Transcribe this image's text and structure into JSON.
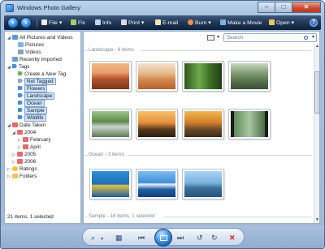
{
  "window": {
    "title": "Windows Photo Gallery",
    "controls": [
      "–",
      "□",
      "✕"
    ]
  },
  "toolbar": {
    "items": [
      {
        "label": "File",
        "icon": "file-icon"
      },
      {
        "label": "Fix",
        "icon": "fix-icon"
      },
      {
        "label": "Info",
        "icon": "info-icon"
      },
      {
        "label": "Print",
        "icon": "print-icon"
      },
      {
        "label": "E-mail",
        "icon": "email-icon"
      },
      {
        "label": "Burn",
        "icon": "burn-icon"
      },
      {
        "label": "Make a Movie",
        "icon": "movie-icon"
      },
      {
        "label": "Open",
        "icon": "open-icon"
      }
    ],
    "help": "?"
  },
  "nav": {
    "all": "All Pictures and Videos",
    "pictures": "Pictures",
    "videos": "Videos",
    "recent": "Recently Imported",
    "tags": "Tags",
    "create_tag": "Create a New Tag",
    "not_tagged": "Not Tagged",
    "flowers": "Flowers",
    "landscape": "Landscape",
    "ocean": "Ocean",
    "sample": "Sample",
    "wildlife": "Wildlife",
    "date_taken": "Date Taken",
    "y2004": "2004",
    "february": "February",
    "april": "April",
    "y2005": "2005",
    "y2006": "2006",
    "ratings": "Ratings",
    "folders": "Folders"
  },
  "status": "21 items, 1 selected",
  "search": {
    "placeholder": "Search"
  },
  "groups": {
    "landscape": "Landscape - 8 items",
    "ocean": "Ocean - 3 items",
    "sample": "Sample - 18 items, 1 selected"
  },
  "colors": {
    "toolbar": "#1d3352",
    "selection": "#cfe3fb",
    "accent": "#2a80d8"
  }
}
